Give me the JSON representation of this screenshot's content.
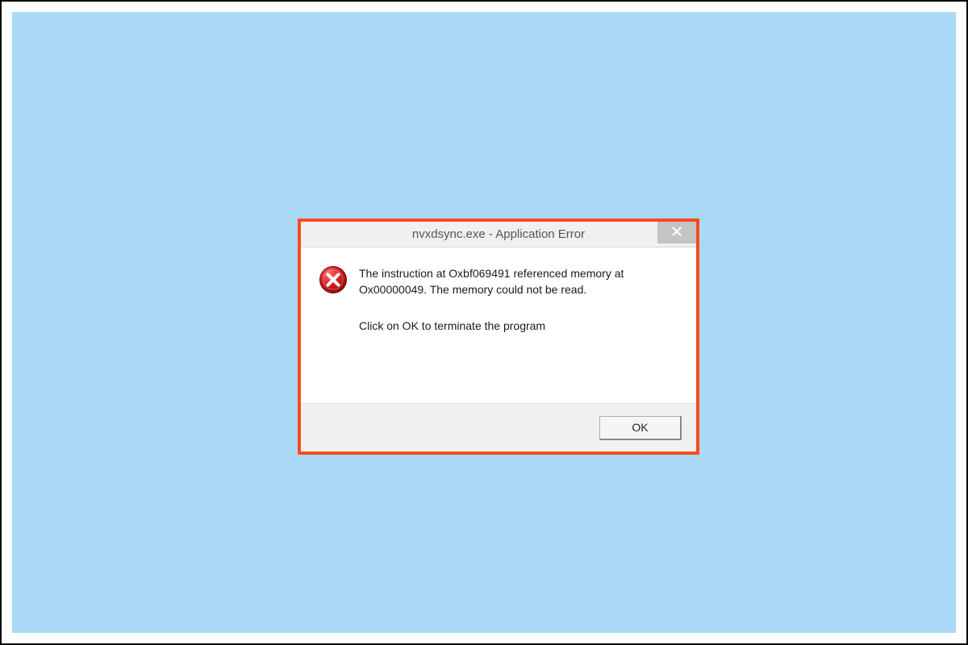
{
  "dialog": {
    "title": "nvxdsync.exe - Application Error",
    "message_line1": "The instruction at Oxbf069491 referenced memory at Ox00000049. The memory could not be read.",
    "message_line2": "Click on OK to terminate the program",
    "ok_label": "OK"
  }
}
